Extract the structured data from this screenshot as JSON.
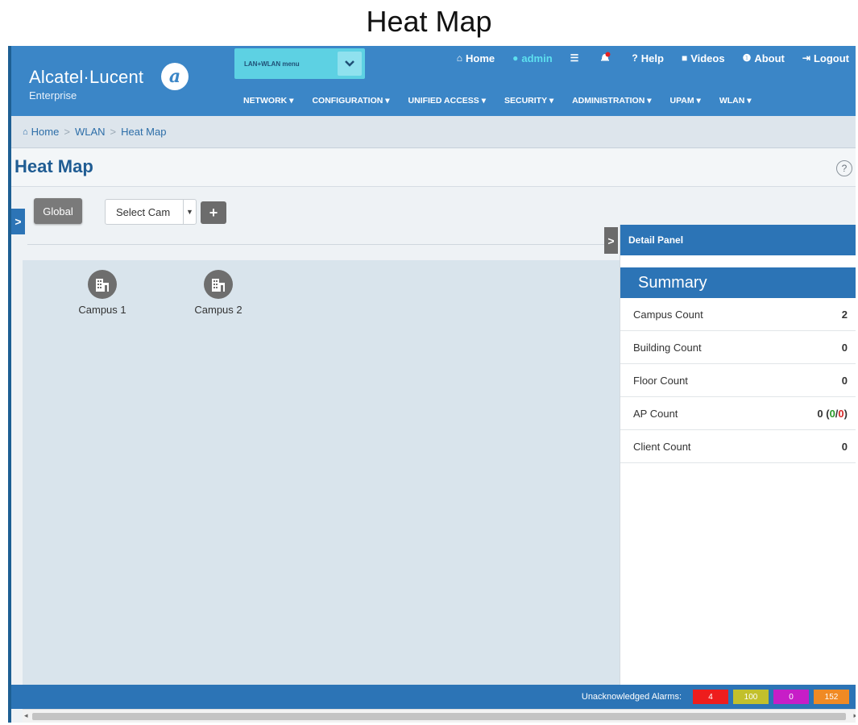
{
  "figure": {
    "title": "Heat Map"
  },
  "brand": {
    "name": "Alcatel·Lucent",
    "sub": "Enterprise"
  },
  "menu_select": {
    "label": "LAN+WLAN menu"
  },
  "topnav": [
    {
      "icon": "home-icon",
      "label": "Home"
    },
    {
      "icon": "user-icon",
      "label": "admin"
    },
    {
      "icon": "list-icon",
      "label": ""
    },
    {
      "icon": "bell-icon",
      "label": ""
    },
    {
      "icon": "question-icon",
      "label": "Help"
    },
    {
      "icon": "video-icon",
      "label": "Videos"
    },
    {
      "icon": "info-icon",
      "label": "About"
    },
    {
      "icon": "logout-icon",
      "label": "Logout"
    }
  ],
  "mainnav": [
    "NETWORK ▾",
    "CONFIGURATION ▾",
    "UNIFIED ACCESS ▾",
    "SECURITY ▾",
    "ADMINISTRATION ▾",
    "UPAM ▾",
    "WLAN ▾"
  ],
  "breadcrumb": {
    "home": "Home",
    "wlan": "WLAN",
    "current": "Heat Map"
  },
  "page": {
    "title": "Heat Map"
  },
  "toolbar": {
    "global": "Global",
    "campus_select": "Select Cam"
  },
  "map": {
    "campuses": [
      "Campus 1",
      "Campus 2"
    ]
  },
  "detail_panel": {
    "title": "Detail Panel",
    "summary_title": "Summary",
    "rows": [
      {
        "label": "Campus Count",
        "value": "2"
      },
      {
        "label": "Building Count",
        "value": "0"
      },
      {
        "label": "Floor Count",
        "value": "0"
      },
      {
        "label": "AP Count",
        "value": "0",
        "up": "0",
        "down": "0"
      },
      {
        "label": "Client Count",
        "value": "0"
      }
    ]
  },
  "footer": {
    "alarm_label": "Unacknowledged Alarms:",
    "alarms": [
      {
        "value": "4",
        "color": "#ee1d1d"
      },
      {
        "value": "100",
        "color": "#c2c02c"
      },
      {
        "value": "0",
        "color": "#c71ec7"
      },
      {
        "value": "152",
        "color": "#f08a24"
      }
    ]
  },
  "colors": {
    "header": "#3b86c7",
    "accent": "#2c74b6",
    "select": "#5dd1e3"
  }
}
